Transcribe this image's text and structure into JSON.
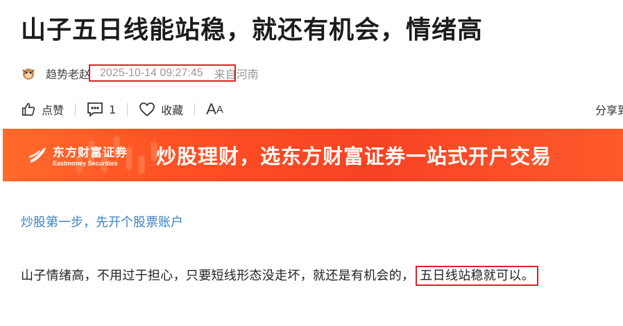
{
  "article": {
    "title": "山子五日线能站稳，就还有机会，情绪高",
    "author": "趋势老赵",
    "published": "2025-10-14 09:27:45",
    "location": "来自河南"
  },
  "actions": {
    "like_label": "点赞",
    "comment_count": "1",
    "collect_label": "收藏",
    "font_size_label": "A",
    "font_size_small": "A",
    "share_label": "分享到"
  },
  "banner": {
    "logo_cn": "东方财富证券",
    "logo_en": "Eastmoney Securities",
    "slogan": "炒股理财，选东方财富证券一站式开户交易"
  },
  "body": {
    "link_text": "炒股第一步，先开个股票账户",
    "paragraph_text": "山子情绪高，不用过于担心，只要短线形态没走坏，就还是有机会的，",
    "paragraph_highlight": "五日线站稳就可以。"
  },
  "colors": {
    "accent_link": "#3b82c4",
    "highlight_box": "#d22222",
    "banner_orange": "#ff5526"
  }
}
